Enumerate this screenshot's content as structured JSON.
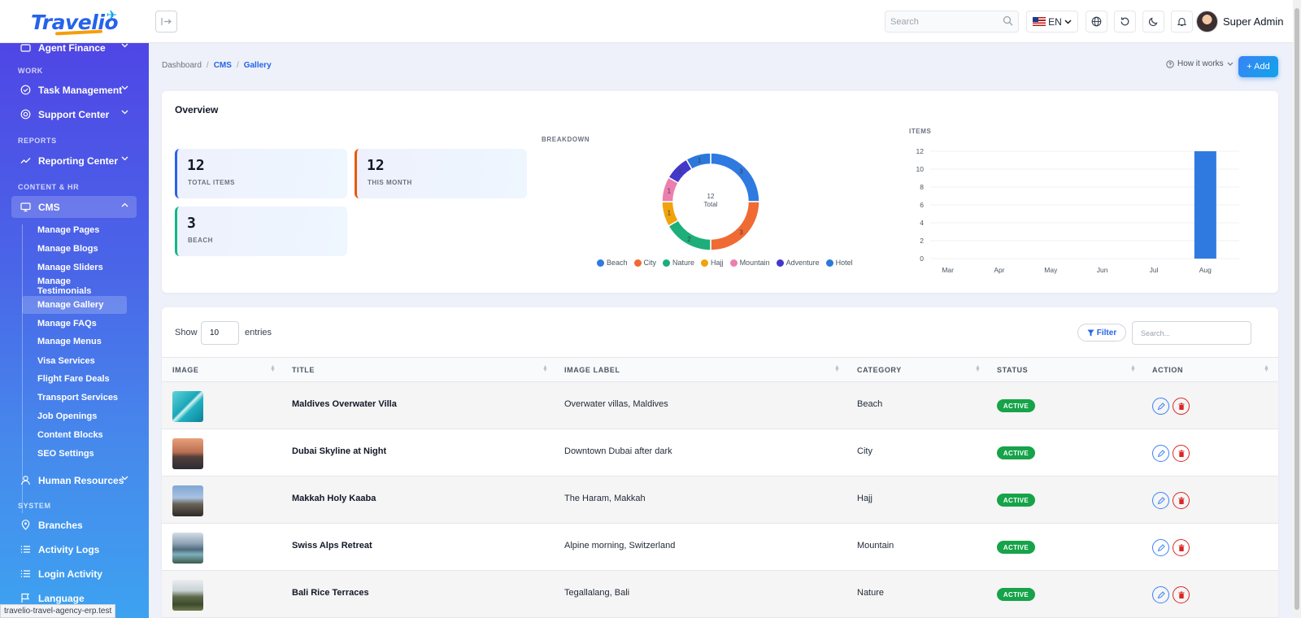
{
  "app": {
    "logo": "Travelio"
  },
  "topbar": {
    "search_placeholder": "Search",
    "language": "EN",
    "user_name": "Super Admin"
  },
  "sidebar": {
    "partial_item": "Agent Finance",
    "sections": {
      "work": "WORK",
      "reports": "REPORTS",
      "content_hr": "CONTENT & HR",
      "system": "SYSTEM"
    },
    "items": {
      "task_management": "Task Management",
      "support_center": "Support Center",
      "reporting_center": "Reporting Center",
      "cms": "CMS",
      "human_resources": "Human Resources",
      "branches": "Branches",
      "activity_logs": "Activity Logs",
      "login_activity": "Login Activity",
      "language": "Language"
    },
    "cms_sub": [
      "Manage Pages",
      "Manage Blogs",
      "Manage Sliders",
      "Manage Testimonials",
      "Manage Gallery",
      "Manage FAQs",
      "Manage Menus",
      "Visa Services",
      "Flight Fare Deals",
      "Transport Services",
      "Job Openings",
      "Content Blocks",
      "SEO Settings"
    ]
  },
  "breadcrumb": {
    "root": "Dashboard",
    "sep": "/",
    "parent": "CMS",
    "current": "Gallery"
  },
  "actions": {
    "how_it_works": "How it works",
    "add": "+ Add"
  },
  "overview": {
    "title": "Overview",
    "stats": [
      {
        "value": "12",
        "label": "TOTAL ITEMS",
        "color": "#2563eb"
      },
      {
        "value": "12",
        "label": "THIS MONTH",
        "color": "#ea580c"
      },
      {
        "value": "3",
        "label": "BEACH",
        "color": "#10b981"
      }
    ],
    "breakdown_label": "BREAKDOWN",
    "items_label": "ITEMS",
    "donut_center_value": "12",
    "donut_center_label": "Total"
  },
  "chart_data": [
    {
      "type": "pie",
      "title": "BREAKDOWN",
      "style": "donut",
      "categories": [
        "Beach",
        "City",
        "Nature",
        "Hajj",
        "Mountain",
        "Adventure",
        "Hotel"
      ],
      "values": [
        3,
        3,
        2,
        1,
        1,
        1,
        1
      ],
      "colors": [
        "#2f7ae0",
        "#f06a34",
        "#1dae7a",
        "#f0a30a",
        "#ec7fae",
        "#4338ca",
        "#2b78db"
      ],
      "slice_labels": [
        "3",
        "3",
        "2",
        "1",
        "1",
        "1",
        "1"
      ],
      "legend_position": "bottom"
    },
    {
      "type": "bar",
      "title": "ITEMS",
      "categories": [
        "Mar",
        "Apr",
        "May",
        "Jun",
        "Jul",
        "Aug"
      ],
      "values": [
        0,
        0,
        0,
        0,
        0,
        12
      ],
      "y_ticks": [
        0,
        2,
        4,
        6,
        8,
        10,
        12
      ],
      "ylim": [
        0,
        12
      ],
      "color": "#2f7ae0",
      "grid": true
    }
  ],
  "table": {
    "show_label": "Show",
    "page_size": "10",
    "entries_label": "entries",
    "filter_label": "Filter",
    "search_placeholder": "Search...",
    "columns": [
      "IMAGE",
      "TITLE",
      "IMAGE LABEL",
      "CATEGORY",
      "STATUS",
      "ACTION"
    ],
    "rows": [
      {
        "title": "Maldives Overwater Villa",
        "label": "Overwater villas, Maldives",
        "category": "Beach",
        "status": "ACTIVE"
      },
      {
        "title": "Dubai Skyline at Night",
        "label": "Downtown Dubai after dark",
        "category": "City",
        "status": "ACTIVE"
      },
      {
        "title": "Makkah Holy Kaaba",
        "label": "The Haram, Makkah",
        "category": "Hajj",
        "status": "ACTIVE"
      },
      {
        "title": "Swiss Alps Retreat",
        "label": "Alpine morning, Switzerland",
        "category": "Mountain",
        "status": "ACTIVE"
      },
      {
        "title": "Bali Rice Terraces",
        "label": "Tegallalang, Bali",
        "category": "Nature",
        "status": "ACTIVE"
      }
    ]
  },
  "browser_status": "travelio-travel-agency-erp.test"
}
